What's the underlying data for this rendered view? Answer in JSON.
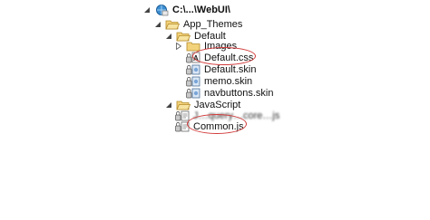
{
  "tree": {
    "root": {
      "label": "C:\\...\\WebUI\\",
      "icon": "web-project-icon"
    },
    "app_themes": {
      "label": "App_Themes",
      "icon": "folder-open-icon"
    },
    "default_folder": {
      "label": "Default",
      "icon": "folder-open-icon"
    },
    "images": {
      "label": "Images",
      "icon": "folder-icon"
    },
    "default_css": {
      "label": "Default.css",
      "icon": "css-file-icon"
    },
    "default_skin": {
      "label": "Default.skin",
      "icon": "skin-file-icon"
    },
    "memo_skin": {
      "label": "memo.skin",
      "icon": "skin-file-icon"
    },
    "navbuttons_skin": {
      "label": "navbuttons.skin",
      "icon": "skin-file-icon"
    },
    "javascript": {
      "label": "JavaScript",
      "icon": "folder-open-icon"
    },
    "blurred_js": {
      "label": "J…query…core…js",
      "icon": "js-file-icon"
    },
    "common_js": {
      "label": "Common.js",
      "icon": "js-file-icon"
    }
  },
  "colors": {
    "annotation": "#d23a3a",
    "folder": "#e8c25c",
    "folder_outline": "#b48a2a"
  }
}
